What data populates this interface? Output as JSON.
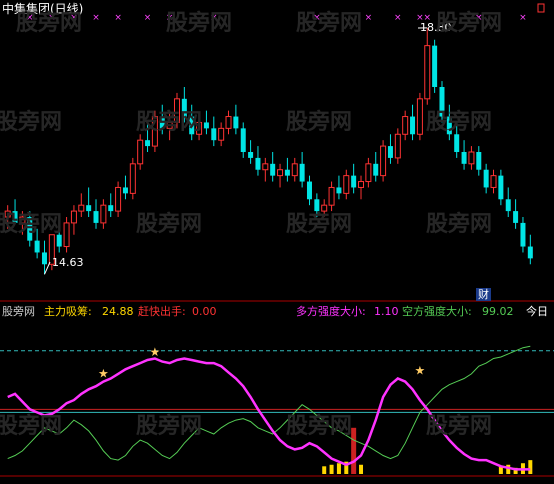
{
  "title": "中集集团(日线)",
  "watermark": "股旁网",
  "price_panel": {
    "high_label": "18.80",
    "low_label": "14.63",
    "badge": "财",
    "colors": {
      "up": "#ff3333",
      "down": "#00e5e5",
      "marker": "#ff44ff"
    }
  },
  "indicator_panel": {
    "source": "股旁网",
    "name": "主力吸筹:",
    "name_value": "24.88",
    "warn_label": "赶快出手:",
    "warn_value": "0.00",
    "bull_label": "多方强度大小:",
    "bull_value": "1.10",
    "bear_label": "空方强度大小:",
    "bear_value": "99.02",
    "today": "今日",
    "colors": {
      "magenta": "#ff33ff",
      "green": "#55cc55",
      "cyan": "#33bbbb",
      "red": "#cc2222",
      "yellow": "#ffd700",
      "runner": "#ffcc66"
    }
  },
  "chart_data": {
    "type": "candlestick",
    "title": "中集集团(日线)",
    "ohlc": [
      [
        15.6,
        15.8,
        15.4,
        15.7
      ],
      [
        15.7,
        15.9,
        15.5,
        15.5
      ],
      [
        15.5,
        15.7,
        15.3,
        15.6
      ],
      [
        15.6,
        15.7,
        15.1,
        15.2
      ],
      [
        15.2,
        15.4,
        14.9,
        15.0
      ],
      [
        15.0,
        15.2,
        14.63,
        14.8
      ],
      [
        14.8,
        15.3,
        14.7,
        15.3
      ],
      [
        15.3,
        15.5,
        15.0,
        15.1
      ],
      [
        15.1,
        15.6,
        15.0,
        15.5
      ],
      [
        15.5,
        15.8,
        15.3,
        15.7
      ],
      [
        15.7,
        16.0,
        15.6,
        15.8
      ],
      [
        15.8,
        16.1,
        15.6,
        15.7
      ],
      [
        15.7,
        15.9,
        15.4,
        15.5
      ],
      [
        15.5,
        15.9,
        15.4,
        15.8
      ],
      [
        15.8,
        16.0,
        15.6,
        15.7
      ],
      [
        15.7,
        16.2,
        15.6,
        16.1
      ],
      [
        16.1,
        16.3,
        15.9,
        16.0
      ],
      [
        16.0,
        16.6,
        15.9,
        16.5
      ],
      [
        16.5,
        17.0,
        16.4,
        16.9
      ],
      [
        16.9,
        17.2,
        16.7,
        16.8
      ],
      [
        16.8,
        17.4,
        16.7,
        17.3
      ],
      [
        17.3,
        17.5,
        17.0,
        17.1
      ],
      [
        17.1,
        17.4,
        16.9,
        17.2
      ],
      [
        17.2,
        17.7,
        17.1,
        17.6
      ],
      [
        17.6,
        17.8,
        17.2,
        17.3
      ],
      [
        17.3,
        17.5,
        16.9,
        17.0
      ],
      [
        17.0,
        17.3,
        16.9,
        17.2
      ],
      [
        17.2,
        17.4,
        17.0,
        17.1
      ],
      [
        17.1,
        17.3,
        16.8,
        16.9
      ],
      [
        16.9,
        17.2,
        16.8,
        17.1
      ],
      [
        17.1,
        17.4,
        17.0,
        17.3
      ],
      [
        17.3,
        17.5,
        17.0,
        17.1
      ],
      [
        17.1,
        17.2,
        16.6,
        16.7
      ],
      [
        16.7,
        16.9,
        16.5,
        16.6
      ],
      [
        16.6,
        16.8,
        16.3,
        16.4
      ],
      [
        16.4,
        16.6,
        16.2,
        16.5
      ],
      [
        16.5,
        16.7,
        16.2,
        16.3
      ],
      [
        16.3,
        16.5,
        16.1,
        16.4
      ],
      [
        16.4,
        16.6,
        16.2,
        16.3
      ],
      [
        16.3,
        16.6,
        16.2,
        16.5
      ],
      [
        16.5,
        16.7,
        16.1,
        16.2
      ],
      [
        16.2,
        16.3,
        15.8,
        15.9
      ],
      [
        15.9,
        16.0,
        15.6,
        15.7
      ],
      [
        15.7,
        15.9,
        15.6,
        15.8
      ],
      [
        15.8,
        16.2,
        15.7,
        16.1
      ],
      [
        16.1,
        16.3,
        15.9,
        16.0
      ],
      [
        16.0,
        16.4,
        15.9,
        16.3
      ],
      [
        16.3,
        16.5,
        16.0,
        16.1
      ],
      [
        16.1,
        16.3,
        15.9,
        16.2
      ],
      [
        16.2,
        16.6,
        16.1,
        16.5
      ],
      [
        16.5,
        16.7,
        16.2,
        16.3
      ],
      [
        16.3,
        16.9,
        16.2,
        16.8
      ],
      [
        16.8,
        17.0,
        16.5,
        16.6
      ],
      [
        16.6,
        17.1,
        16.5,
        17.0
      ],
      [
        17.0,
        17.4,
        16.9,
        17.3
      ],
      [
        17.3,
        17.5,
        16.9,
        17.0
      ],
      [
        17.0,
        17.7,
        16.9,
        17.6
      ],
      [
        17.6,
        18.8,
        17.5,
        18.5
      ],
      [
        18.5,
        18.6,
        17.7,
        17.8
      ],
      [
        17.8,
        17.9,
        17.2,
        17.3
      ],
      [
        17.3,
        17.5,
        16.9,
        17.0
      ],
      [
        17.0,
        17.2,
        16.6,
        16.7
      ],
      [
        16.7,
        16.9,
        16.4,
        16.5
      ],
      [
        16.5,
        16.8,
        16.4,
        16.7
      ],
      [
        16.7,
        16.8,
        16.3,
        16.4
      ],
      [
        16.4,
        16.5,
        16.0,
        16.1
      ],
      [
        16.1,
        16.4,
        16.0,
        16.3
      ],
      [
        16.3,
        16.4,
        15.8,
        15.9
      ],
      [
        15.9,
        16.1,
        15.6,
        15.7
      ],
      [
        15.7,
        15.9,
        15.4,
        15.5
      ],
      [
        15.5,
        15.6,
        15.0,
        15.1
      ],
      [
        15.1,
        15.3,
        14.8,
        14.9
      ]
    ],
    "markers": [
      3,
      6,
      9,
      12,
      15,
      19,
      22,
      28,
      42,
      49,
      53,
      56,
      57,
      64,
      70
    ],
    "indicator": {
      "magenta": [
        50,
        52,
        47,
        42,
        40,
        38,
        39,
        42,
        46,
        48,
        52,
        55,
        57,
        60,
        62,
        65,
        68,
        70,
        72,
        74,
        75,
        73,
        72,
        74,
        75,
        74,
        73,
        72,
        72,
        70,
        66,
        62,
        57,
        50,
        42,
        35,
        28,
        22,
        18,
        16,
        17,
        20,
        18,
        14,
        10,
        8,
        6,
        8,
        12,
        22,
        35,
        50,
        58,
        62,
        60,
        55,
        48,
        42,
        35,
        28,
        22,
        17,
        13,
        10,
        9,
        9,
        7,
        5,
        4,
        3,
        3,
        3
      ],
      "green": [
        10,
        12,
        15,
        20,
        25,
        30,
        28,
        26,
        30,
        35,
        32,
        28,
        22,
        15,
        10,
        9,
        12,
        18,
        22,
        20,
        16,
        12,
        10,
        14,
        20,
        25,
        30,
        28,
        26,
        30,
        33,
        35,
        36,
        34,
        30,
        28,
        26,
        30,
        35,
        40,
        45,
        42,
        38,
        34,
        30,
        28,
        25,
        22,
        20,
        18,
        15,
        12,
        10,
        12,
        20,
        30,
        40,
        45,
        50,
        55,
        58,
        60,
        62,
        65,
        70,
        72,
        75,
        76,
        78,
        80,
        82,
        83
      ],
      "bars": [
        0,
        0,
        0,
        0,
        0,
        0,
        0,
        0,
        0,
        0,
        0,
        0,
        0,
        0,
        0,
        0,
        0,
        0,
        0,
        0,
        0,
        0,
        0,
        0,
        0,
        0,
        0,
        0,
        0,
        0,
        0,
        0,
        0,
        0,
        0,
        0,
        0,
        0,
        0,
        0,
        0,
        0,
        0,
        5,
        6,
        7,
        8,
        9,
        6,
        0,
        0,
        0,
        0,
        0,
        0,
        0,
        0,
        0,
        0,
        0,
        0,
        0,
        0,
        0,
        0,
        0,
        0,
        5,
        6,
        4,
        7,
        9
      ],
      "spike_index": 47
    }
  }
}
